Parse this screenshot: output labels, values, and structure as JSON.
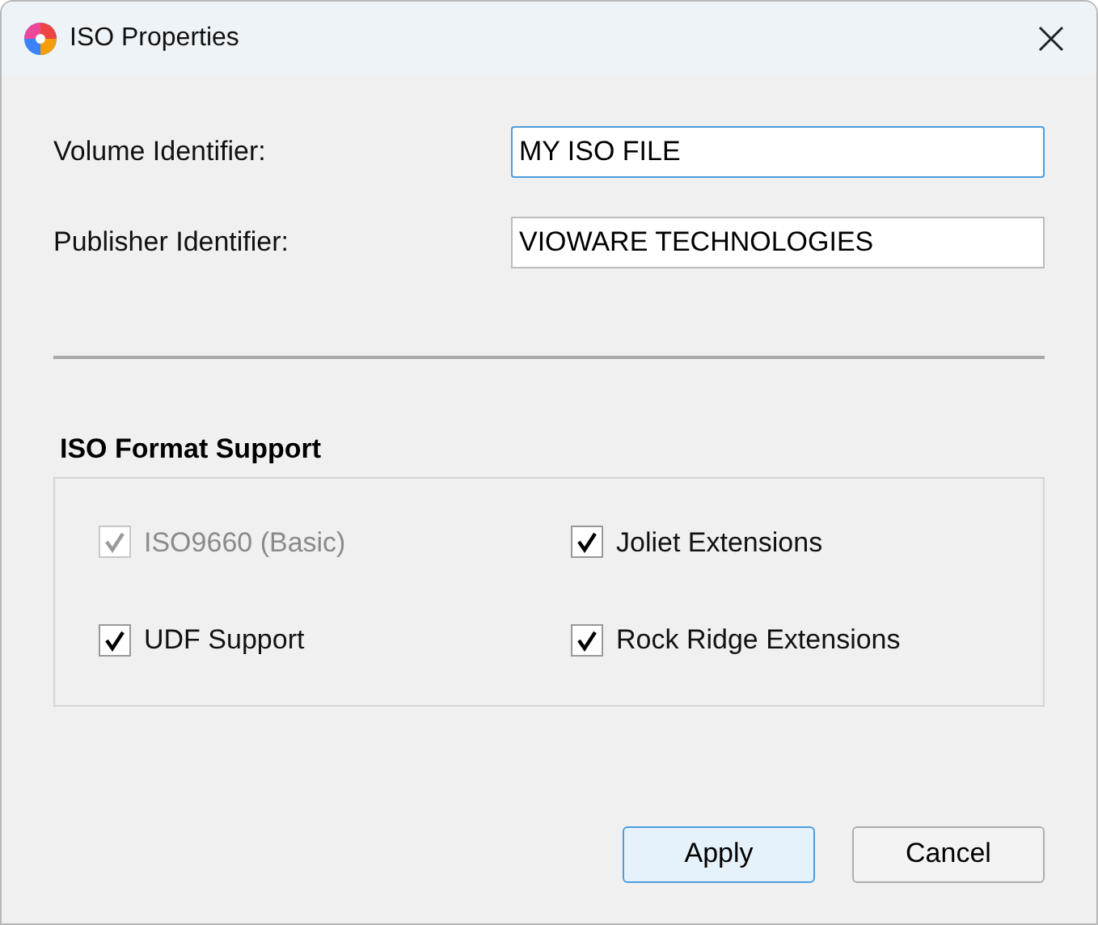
{
  "window": {
    "title": "ISO Properties"
  },
  "fields": [
    {
      "label": "Volume Identifier:",
      "value": "MY ISO FILE",
      "focused": true
    },
    {
      "label": "Publisher Identifier:",
      "value": "VIOWARE TECHNOLOGIES",
      "focused": false
    }
  ],
  "group": {
    "title": "ISO Format Support",
    "options": [
      {
        "label": "ISO9660 (Basic)",
        "checked": true,
        "disabled": true
      },
      {
        "label": "Joliet Extensions",
        "checked": true,
        "disabled": false
      },
      {
        "label": "UDF Support",
        "checked": true,
        "disabled": false
      },
      {
        "label": "Rock Ridge Extensions",
        "checked": true,
        "disabled": false
      }
    ]
  },
  "buttons": [
    {
      "label": "Apply",
      "default": true
    },
    {
      "label": "Cancel",
      "default": false
    }
  ]
}
